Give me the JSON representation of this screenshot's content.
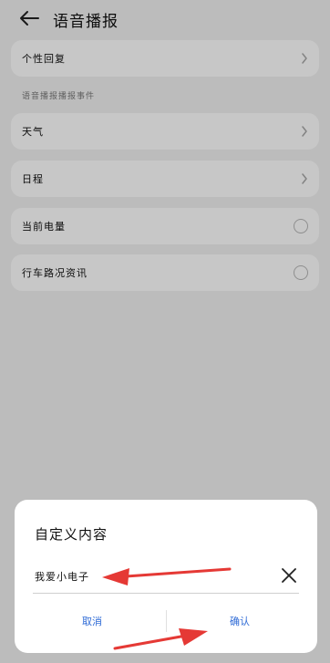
{
  "header": {
    "title": "语音播报"
  },
  "cards": [
    {
      "label": "个性回复",
      "control": "chevron"
    },
    {
      "label": "天气",
      "control": "chevron"
    },
    {
      "label": "日程",
      "control": "chevron"
    },
    {
      "label": "当前电量",
      "control": "radio"
    },
    {
      "label": "行车路况资讯",
      "control": "radio"
    }
  ],
  "section": {
    "label": "语音播报播报事件"
  },
  "dialog": {
    "title": "自定义内容",
    "input_value": "我爱小电子",
    "cancel_label": "取消",
    "confirm_label": "确认"
  },
  "colors": {
    "accent": "#2f6bd6",
    "annotation": "#e53935"
  },
  "icons": [
    "back-arrow-icon",
    "chevron-right-icon",
    "close-icon"
  ]
}
